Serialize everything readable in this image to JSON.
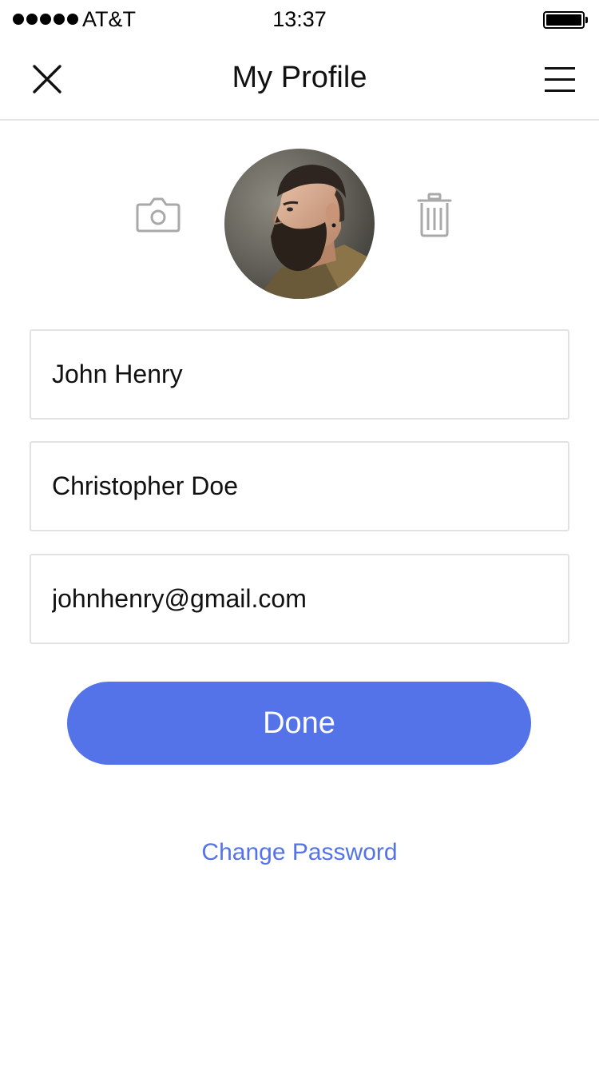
{
  "status_bar": {
    "carrier": "AT&T",
    "time": "13:37",
    "signal_bars": 5,
    "battery_level": 1.0
  },
  "nav": {
    "title": "My Profile",
    "close_icon": "close-icon",
    "menu_icon": "hamburger-menu-icon"
  },
  "profile": {
    "camera_icon": "camera-icon",
    "trash_icon": "trash-icon",
    "avatar_description": "bearded-man-profile-photo"
  },
  "form": {
    "first_name": "John Henry",
    "last_name": "Christopher Doe",
    "email": "johnhenry@gmail.com"
  },
  "actions": {
    "done_label": "Done",
    "change_password_label": "Change Password"
  },
  "colors": {
    "accent": "#5573e8",
    "icon_gray": "#a9a9a9",
    "border": "#e2e2e2"
  }
}
